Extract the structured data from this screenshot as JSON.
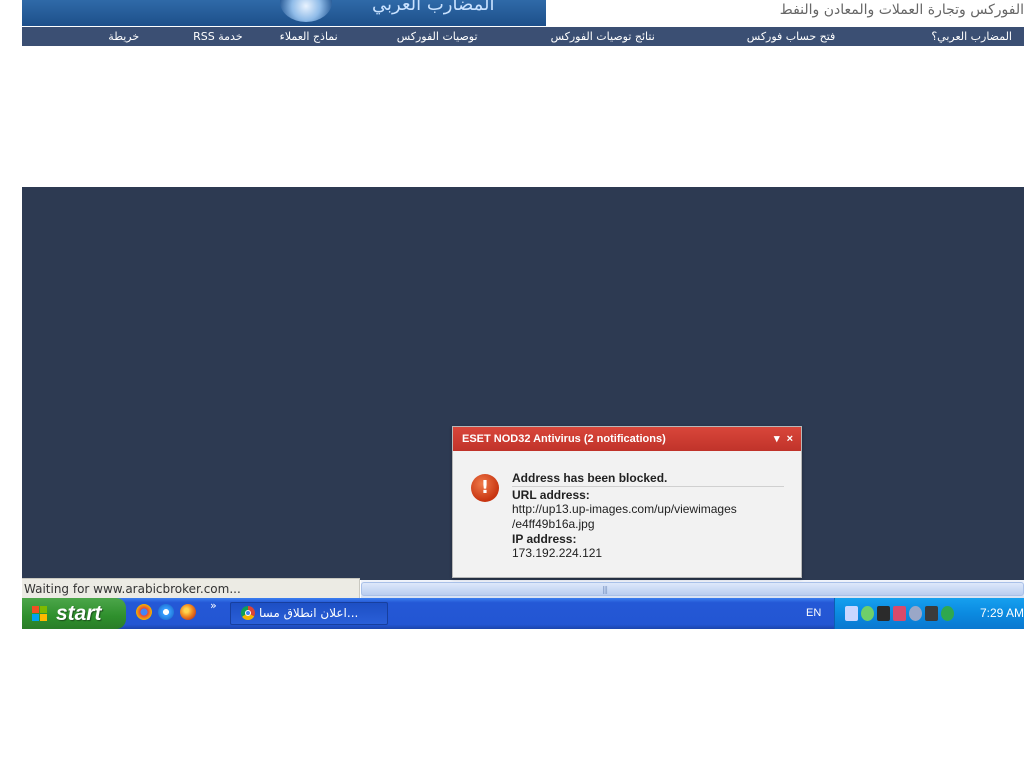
{
  "site": {
    "logo_text": "المضارب العربي",
    "tagline": "الفوركس وتجارة العملات والمعادن والنفط",
    "nav": [
      {
        "label": "المضارب العربي؟"
      },
      {
        "label": "فتح حساب فوركس"
      },
      {
        "label": "نتائج توصيات الفوركس"
      },
      {
        "label": "توصيات الفوركس"
      },
      {
        "label": "نماذج العملاء"
      },
      {
        "label": "خدمة RSS"
      },
      {
        "label": "خريطة"
      }
    ]
  },
  "browser": {
    "status_text": "Waiting for www.arabicbroker.com..."
  },
  "notification": {
    "title": "ESET NOD32 Antivirus (2 notifications)",
    "heading": "Address has been blocked.",
    "url_label": "URL address:",
    "url_line1": "http://up13.up-images.com/up/viewimages",
    "url_line2": "/e4ff49b16a.jpg",
    "ip_label": "IP address:",
    "ip_value": "173.192.224.121",
    "alert_symbol": "!",
    "menu_symbol": "▾",
    "close_symbol": "×"
  },
  "taskbar": {
    "start_label": "start",
    "quick_launch": [
      {
        "icon": "chrome-icon",
        "color": "#e8453c"
      },
      {
        "icon": "internet-explorer-icon",
        "color": "#3aa0ff"
      },
      {
        "icon": "firefox-icon",
        "color": "#f0891f"
      }
    ],
    "more_symbol": "»",
    "task_label": "اعلان انطلاق مسا...",
    "language": "EN",
    "clock": "7:29 AM"
  },
  "colors": {
    "nav_bg": "#3b4f73",
    "dark_area": "#2d3a52",
    "eset_red": "#c9392e",
    "taskbar_blue": "#2356d3",
    "start_green": "#2e8f2c"
  }
}
